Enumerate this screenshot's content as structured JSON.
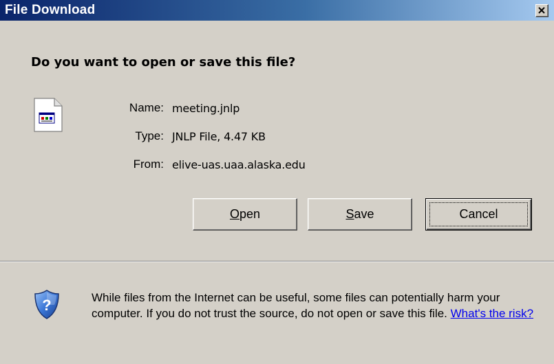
{
  "window": {
    "title": "File Download"
  },
  "dialog": {
    "question": "Do you want to open or save this file?",
    "file": {
      "name_label": "Name:",
      "name_value": "meeting.jnlp",
      "type_label": "Type:",
      "type_value": "JNLP File, 4.47 KB",
      "from_label": "From:",
      "from_value": "elive-uas.uaa.alaska.edu",
      "icon": "document-icon"
    },
    "buttons": {
      "open_prefix": "O",
      "open_rest": "pen",
      "save_prefix": "S",
      "save_rest": "ave",
      "cancel_label": "Cancel"
    },
    "warning": {
      "icon": "security-shield-icon",
      "text": "While files from the Internet can be useful, some files can potentially harm your computer. If you do not trust the source, do not open or save this file. ",
      "link": "What's the risk?"
    }
  },
  "colors": {
    "titlebar_start": "#0a246a",
    "titlebar_end": "#a6caf0",
    "dialog_bg": "#d4d0c8",
    "link": "#0000ee"
  }
}
